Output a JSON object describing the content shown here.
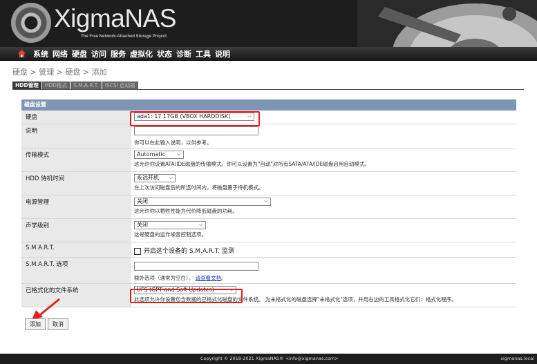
{
  "brand": {
    "name": "XigmaNAS",
    "tagline": "The Free Network-Attached Storage Project"
  },
  "menu": {
    "items": [
      "系统",
      "网络",
      "硬盘",
      "访问",
      "服务",
      "虚拟化",
      "状态",
      "诊断",
      "工具",
      "说明"
    ]
  },
  "breadcrumb": "硬盘 > 管理 > 硬盘 > 添加",
  "tabs": [
    "HDD管理",
    "HDD格式",
    "S.M.A.R.T.",
    "iSCSI 启动器"
  ],
  "section_title": "磁盘设置",
  "fields": {
    "disk": {
      "label": "硬盘",
      "value": "ada1: 17.17GB (VBOX HARDDISK)"
    },
    "description": {
      "label": "说明",
      "value": "",
      "help": "你可以在此输入说明，以供参考。"
    },
    "transfer_mode": {
      "label": "传输模式",
      "value": "Automatic",
      "help": "这允许你设置ATA/IDE磁盘的传输模式。你可以设置为\"自动\"对所有SATA/ATA/IDE磁盘启用自动模式。"
    },
    "standby": {
      "label": "HDD 待机时间",
      "value": "永远开机",
      "help": "在上次访问磁盘后的所选时间内，将磁盘置于待机模式。"
    },
    "power": {
      "label": "电源管理",
      "value": "关闭",
      "help": "这允许你以牺牲性能为代价降低磁盘的功耗。"
    },
    "acoustic": {
      "label": "声学级别",
      "value": "关闭",
      "help": "这是硬盘的运作噪音控制选项。"
    },
    "smart": {
      "label": "S.M.A.R.T.",
      "checkbox_label": "开启这个设备的 S.M.A.R.T. 监测"
    },
    "smart_opts": {
      "label": "S.M.A.R.T. 选项",
      "value": "",
      "help_prefix": "额外选项（通常为空白）。",
      "help_link": "请查看文档"
    },
    "fs": {
      "label": "已格式化的文件系统",
      "value": "UFS (GPT and Soft Updates)",
      "help": "此选项允许你设置包含数据的已格式化磁盘的文件系统。 为未格式化的磁盘选择\"未格式化\"选项，并用右边的工具格式化它们：格式化程序。"
    }
  },
  "buttons": {
    "add": "添加",
    "cancel": "取消"
  },
  "footer": {
    "copyright": "Copyright © 2018-2021 XigmaNAS® <info@xigmanas.com>",
    "host": "xigmanas.local"
  },
  "colors": {
    "section_header": "#7e96b3",
    "highlight": "#e0201e",
    "header_bg": "#1d1d1d"
  }
}
